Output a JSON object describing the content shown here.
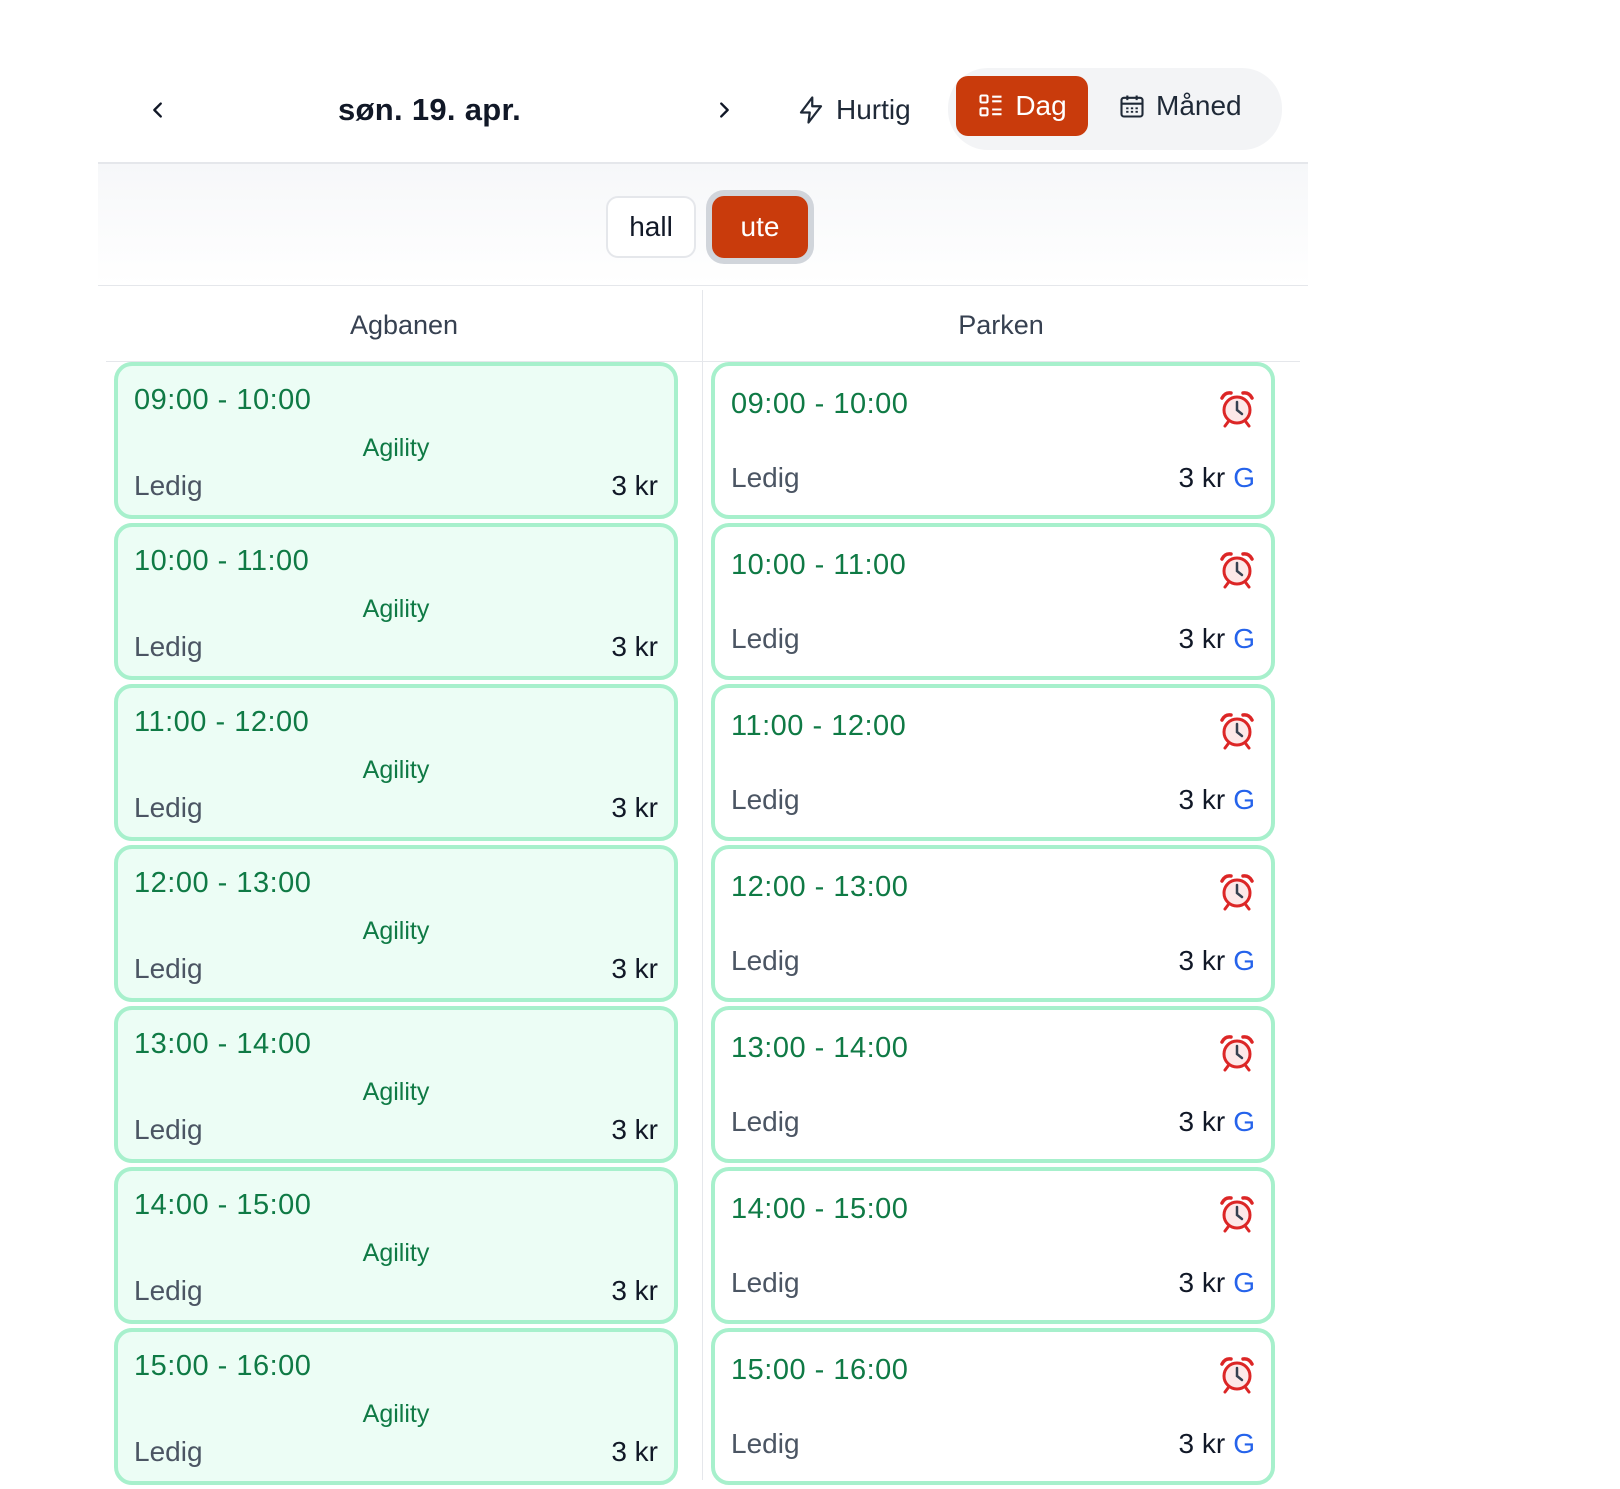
{
  "header": {
    "date": "søn. 19. apr.",
    "quick_label": "Hurtig",
    "views": [
      {
        "label": "Dag",
        "active": true
      },
      {
        "label": "Måned",
        "active": false
      }
    ],
    "accent": "#c93b0c"
  },
  "filters": [
    {
      "label": "hall",
      "active": false
    },
    {
      "label": "ute",
      "active": true
    }
  ],
  "columns": [
    {
      "name": "Agbanen",
      "slots": [
        {
          "time": "09:00 - 10:00",
          "activity": "Agility",
          "status": "Ledig",
          "price": "3 kr"
        },
        {
          "time": "10:00 - 11:00",
          "activity": "Agility",
          "status": "Ledig",
          "price": "3 kr"
        },
        {
          "time": "11:00 - 12:00",
          "activity": "Agility",
          "status": "Ledig",
          "price": "3 kr"
        },
        {
          "time": "12:00 - 13:00",
          "activity": "Agility",
          "status": "Ledig",
          "price": "3 kr"
        },
        {
          "time": "13:00 - 14:00",
          "activity": "Agility",
          "status": "Ledig",
          "price": "3 kr"
        },
        {
          "time": "14:00 - 15:00",
          "activity": "Agility",
          "status": "Ledig",
          "price": "3 kr"
        },
        {
          "time": "15:00 - 16:00",
          "activity": "Agility",
          "status": "Ledig",
          "price": "3 kr"
        }
      ]
    },
    {
      "name": "Parken",
      "slots": [
        {
          "time": "09:00 - 10:00",
          "status": "Ledig",
          "price": "3 kr",
          "flag": "G",
          "icon": "alarm-clock-icon"
        },
        {
          "time": "10:00 - 11:00",
          "status": "Ledig",
          "price": "3 kr",
          "flag": "G",
          "icon": "alarm-clock-icon"
        },
        {
          "time": "11:00 - 12:00",
          "status": "Ledig",
          "price": "3 kr",
          "flag": "G",
          "icon": "alarm-clock-icon"
        },
        {
          "time": "12:00 - 13:00",
          "status": "Ledig",
          "price": "3 kr",
          "flag": "G",
          "icon": "alarm-clock-icon"
        },
        {
          "time": "13:00 - 14:00",
          "status": "Ledig",
          "price": "3 kr",
          "flag": "G",
          "icon": "alarm-clock-icon"
        },
        {
          "time": "14:00 - 15:00",
          "status": "Ledig",
          "price": "3 kr",
          "flag": "G",
          "icon": "alarm-clock-icon"
        },
        {
          "time": "15:00 - 16:00",
          "status": "Ledig",
          "price": "3 kr",
          "flag": "G",
          "icon": "alarm-clock-icon"
        }
      ]
    }
  ]
}
